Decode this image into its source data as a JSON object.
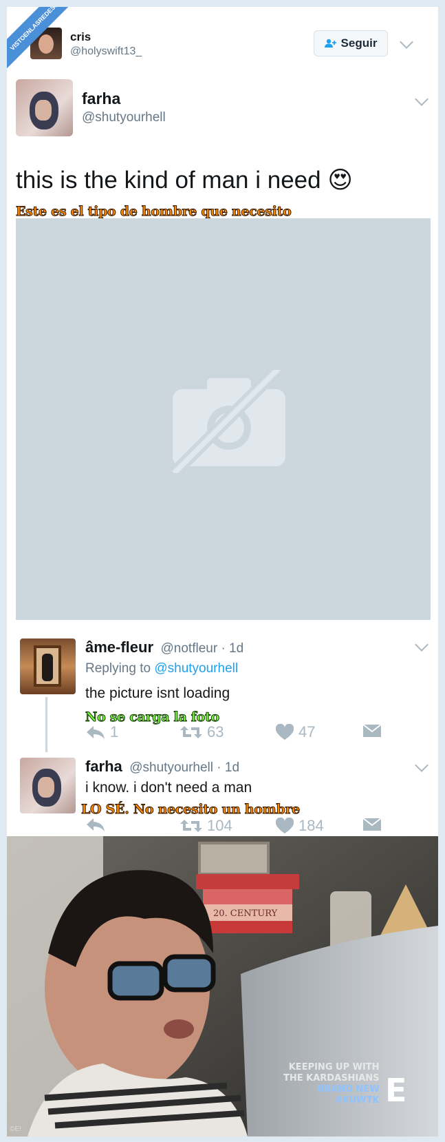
{
  "watermark": "VISTOENLASREDES.com",
  "header_user": {
    "name": "cris",
    "handle": "@holyswift13_",
    "follow_label": "Seguir"
  },
  "tweet": {
    "name": "farha",
    "handle": "@shutyourhell",
    "text": "this is the kind of man i need",
    "emoji": "😍",
    "translation": "Este es el tipo de hombre que necesito"
  },
  "reply1": {
    "name": "âme-fleur",
    "handle_time": "@notfleur · 1d",
    "replying_label": "Replying to",
    "replying_to": "@shutyourhell",
    "text": "the picture isnt loading",
    "translation": "No se carga la foto",
    "replies": "1",
    "retweets": "63",
    "likes": "47"
  },
  "reply2": {
    "name": "farha",
    "handle_time": "@shutyourhell · 1d",
    "text": "i know. i don't need a man",
    "translation": "LO SÉ. No necesito un hombre",
    "replies": "",
    "retweets": "104",
    "likes": "184"
  },
  "tv": {
    "show_line1": "KEEPING UP WITH",
    "show_line2": "THE KARDASHIANS",
    "brand1": "BRAND NEW",
    "brand2": "#KUWTK",
    "network": "E",
    "corner": "©E!",
    "book_title": "20. CENTURY"
  },
  "colors": {
    "accent": "#1da1f2",
    "muted": "#657786",
    "icon": "#aab8c2",
    "subtitle_orange": "#ff8c00",
    "subtitle_green": "#7cf542"
  }
}
